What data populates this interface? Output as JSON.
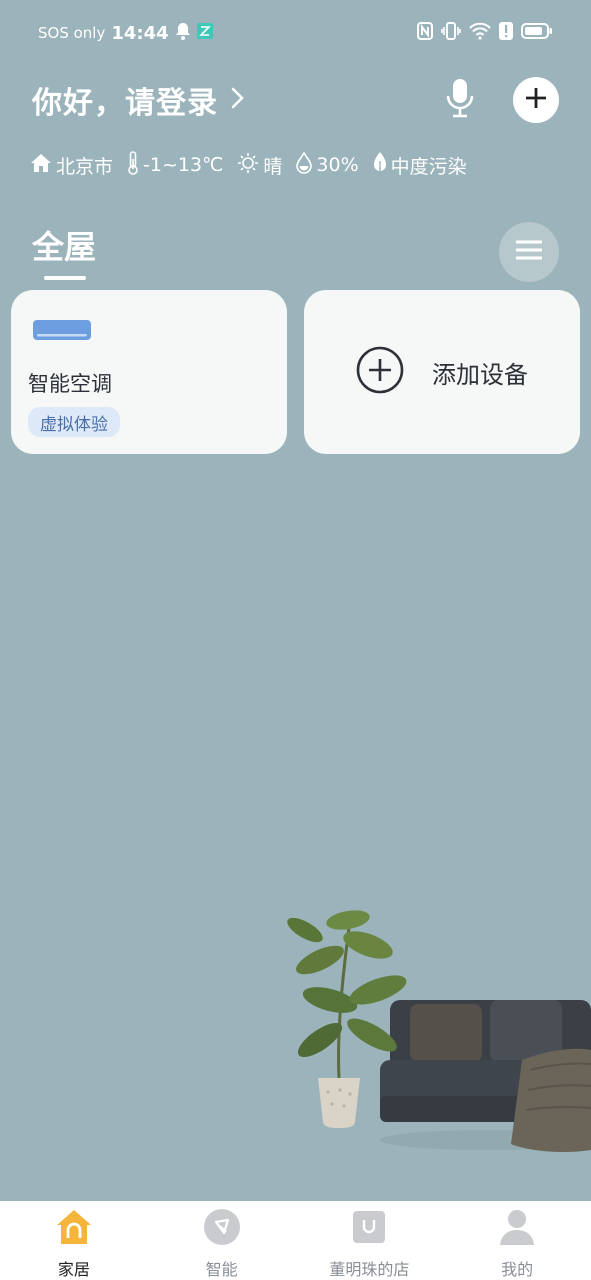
{
  "status_bar": {
    "carrier": "SOS only",
    "time": "14:44"
  },
  "header": {
    "greeting": "你好，请登录"
  },
  "weather": {
    "city": "北京市",
    "temperature": "-1~13℃",
    "condition": "晴",
    "humidity": "30%",
    "air_quality": "中度污染"
  },
  "room": {
    "active_tab": "全屋"
  },
  "devices": [
    {
      "name": "智能空调",
      "badge": "虚拟体验"
    }
  ],
  "add_device": {
    "label": "添加设备"
  },
  "tabbar": {
    "items": [
      {
        "label": "家居",
        "icon": "home-icon",
        "active": true
      },
      {
        "label": "智能",
        "icon": "smart-icon",
        "active": false
      },
      {
        "label": "董明珠的店",
        "icon": "store-icon",
        "active": false
      },
      {
        "label": "我的",
        "icon": "profile-icon",
        "active": false
      }
    ]
  },
  "colors": {
    "background": "#9bb3ba",
    "card": "#f6f8f8",
    "accent": "#f5b53a",
    "badge_bg": "#dde8f8",
    "badge_text": "#4a6fa8"
  }
}
